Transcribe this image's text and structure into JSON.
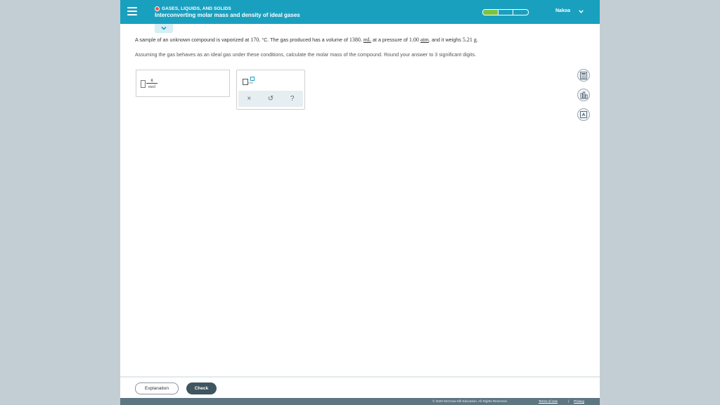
{
  "header": {
    "topic": "GASES, LIQUIDS, AND SOLIDS",
    "lesson_title": "Interconverting molar mass and density of ideal gases",
    "progress": {
      "completed_segments": 1,
      "total_segments": 3
    },
    "user_name": "Nakoa",
    "colors": {
      "bar": "#1aa0bf",
      "status_dot": "#e8543c",
      "progress_done": "#7ec244"
    }
  },
  "question": {
    "line1_a": "A sample of an unknown compound is vaporized at ",
    "temp_value": "170.",
    "temp_unit": " °C.",
    "line1_b": " The gas produced has a volume of ",
    "volume_value": "1380.",
    "volume_unit": "mL",
    "line1_c": " at a pressure of ",
    "pressure_value": "1.00",
    "pressure_unit": "atm",
    "line1_d": ", and it weighs ",
    "mass_value": "5.21",
    "mass_unit": "g",
    "line1_e": ".",
    "line2": "Assuming the gas behaves as an ideal gas under these conditions, calculate the molar mass of the compound. Round your answer to 3 significant digits."
  },
  "answer": {
    "value": "",
    "unit_numerator": "g",
    "unit_denominator": "mol"
  },
  "toolbox": {
    "sci_notation_label": "×10",
    "clear_symbol": "×",
    "undo_symbol": "↺",
    "help_symbol": "?"
  },
  "side_tools": [
    "calculator-icon",
    "data-chart-icon",
    "periodic-table-icon"
  ],
  "footer": {
    "explanation_label": "Explanation",
    "check_label": "Check",
    "copyright": "© 2020 McGraw-Hill Education. All Rights Reserved.",
    "terms_label": "Terms of Use",
    "separator": "|",
    "privacy_label": "Privacy"
  }
}
